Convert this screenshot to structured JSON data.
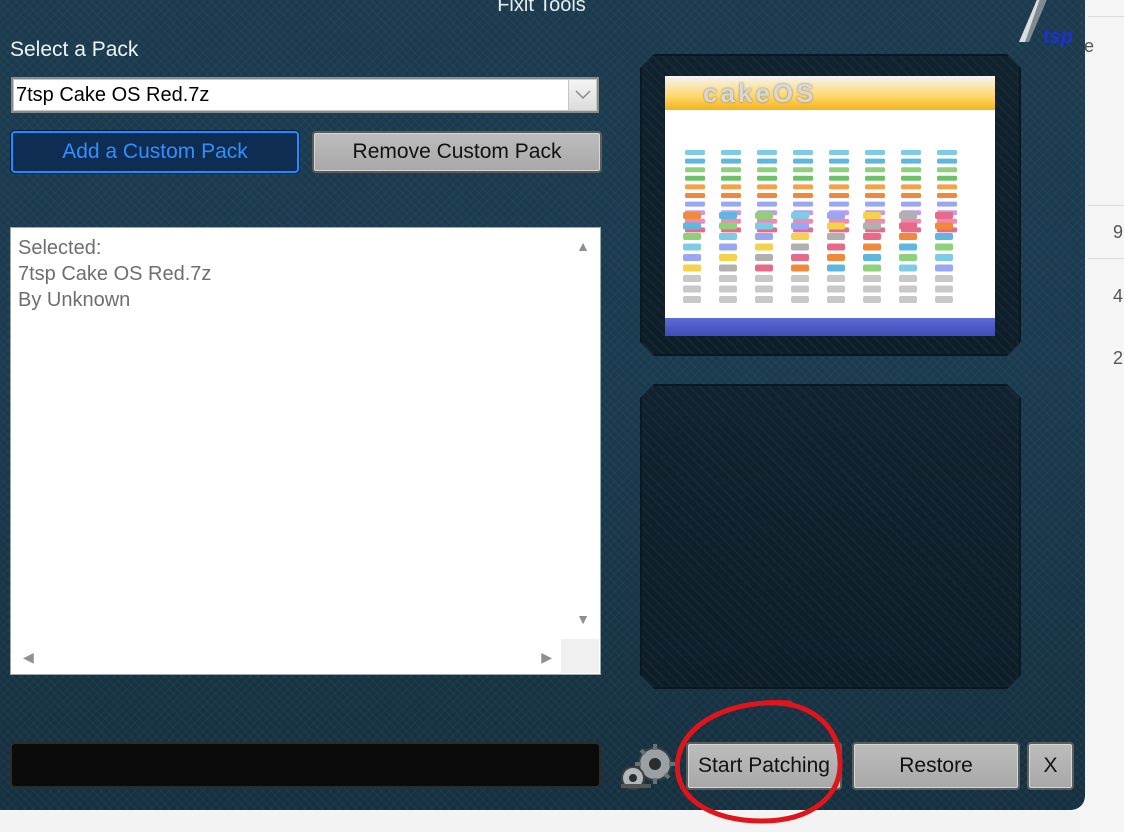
{
  "window": {
    "title": "Fixit Tools",
    "logo_text": "tsp"
  },
  "pack_selector": {
    "label": "Select a Pack",
    "selected_value": "7tsp Cake OS Red.7z"
  },
  "buttons": {
    "add_custom": "Add a Custom Pack",
    "remove_custom": "Remove Custom Pack",
    "start_patching": "Start Patching",
    "restore": "Restore",
    "close": "X"
  },
  "info_box": {
    "lines": [
      "Selected:",
      "7tsp Cake OS Red.7z",
      "By Unknown"
    ]
  },
  "preview": {
    "title": "cakeOS"
  },
  "background_window": {
    "fragments": [
      "e",
      "9",
      "4",
      "2"
    ]
  },
  "colors": {
    "accent_blue": "#1c8cff",
    "window_bg": "#1b3a4e",
    "annotation_red": "#e0141b"
  },
  "icons": {
    "combo_arrow": "chevron-down-icon",
    "gears": "gears-icon"
  }
}
